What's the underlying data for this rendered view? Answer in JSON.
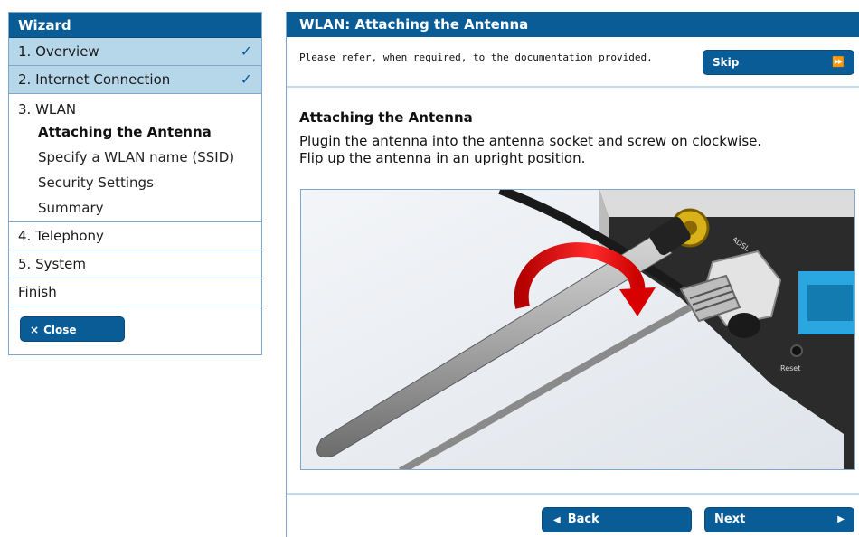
{
  "sidebar": {
    "title": "Wizard",
    "steps": [
      {
        "label": "1. Overview",
        "done": true
      },
      {
        "label": "2. Internet Connection",
        "done": true
      }
    ],
    "wlan": {
      "title": "3. WLAN",
      "substeps": [
        "Attaching the Antenna",
        "Specify a WLAN name (SSID)",
        "Security Settings",
        "Summary"
      ]
    },
    "later_steps": [
      "4. Telephony",
      "5. System",
      "Finish"
    ],
    "check_glyph": "✓",
    "close_label": "Close",
    "close_glyph": "×"
  },
  "main": {
    "title": "WLAN: Attaching the Antenna",
    "notice": "Please refer, when required, to the documentation provided.",
    "skip_label": "Skip",
    "skip_glyph": "⏩",
    "content_title": "Attaching the Antenna",
    "content_lines": [
      "Plugin the antenna into the antenna socket and screw on clockwise.",
      "Flip up the antenna in an upright position."
    ],
    "device_labels": [
      "ADSL",
      "Reset"
    ],
    "back_label": "Back",
    "next_label": "Next",
    "back_glyph": "◀",
    "next_glyph": "▶"
  },
  "colors": {
    "header_blue": "#0a5c97",
    "done_row": "#b6d6ea",
    "border": "#7fa7c9",
    "arrow_red": "#e01a1a",
    "port_blue": "#2aa7e0"
  },
  "icons": [
    "check-icon",
    "close-icon",
    "fast-forward-icon",
    "arrow-left-icon",
    "arrow-right-icon"
  ]
}
